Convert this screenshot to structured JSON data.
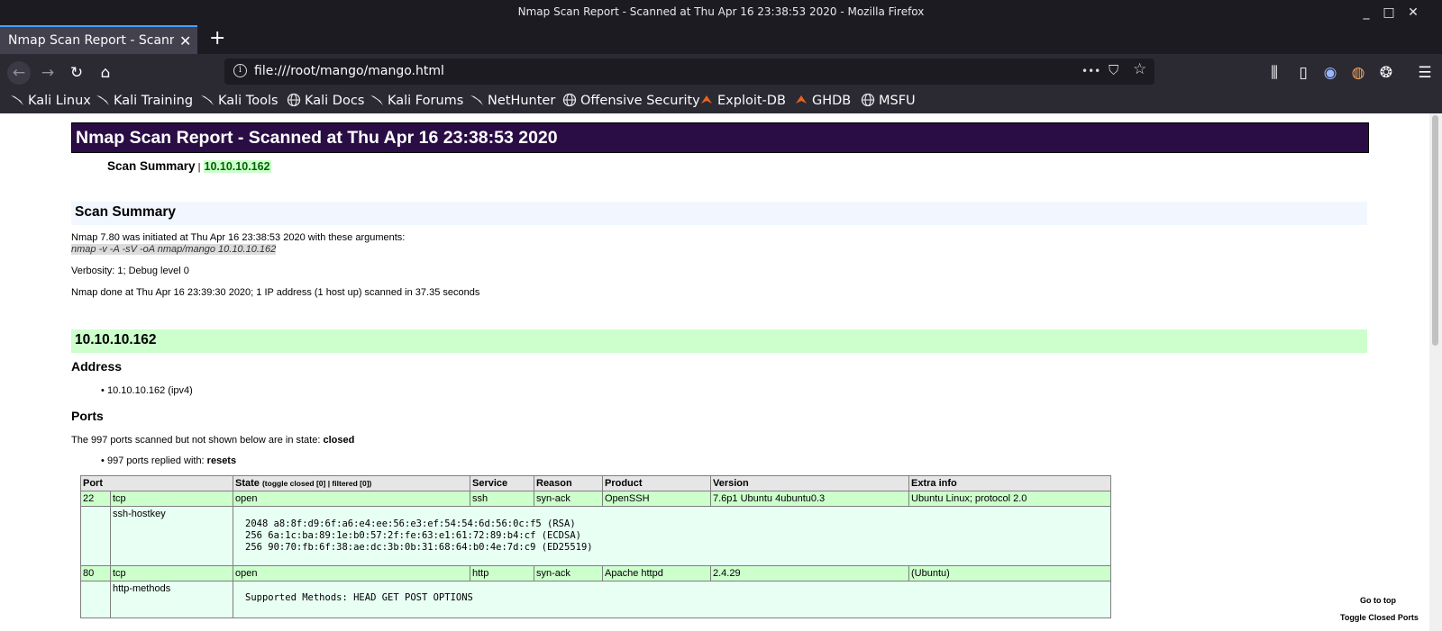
{
  "window": {
    "title": "Nmap Scan Report - Scanned at Thu Apr 16 23:38:53 2020 - Mozilla Firefox",
    "minimize": "_",
    "maximize": "□",
    "close": "✕"
  },
  "tabs": [
    {
      "label": "Nmap Scan Report - Scanned at Thu Apr 16 23:38:53 2020",
      "close": "✕"
    }
  ],
  "new_tab": "+",
  "nav": {
    "back": "←",
    "forward": "→",
    "reload": "↻",
    "home": "⌂",
    "url": "file:///root/mango/mango.html",
    "info": "i",
    "more": "•••",
    "pocket": "⛉",
    "star": "☆",
    "library": "⫼",
    "sidebar": "▯",
    "account": "◉",
    "addon": "◍",
    "extension": "❂",
    "menu": "☰"
  },
  "bookmarks": [
    {
      "label": "Kali Linux",
      "icon": "kali-dragon-icon"
    },
    {
      "label": "Kali Training",
      "icon": "kali-dragon-icon"
    },
    {
      "label": "Kali Tools",
      "icon": "kali-dragon-icon"
    },
    {
      "label": "Kali Docs",
      "icon": "globe-icon"
    },
    {
      "label": "Kali Forums",
      "icon": "kali-dragon-icon"
    },
    {
      "label": "NetHunter",
      "icon": "kali-dragon-icon"
    },
    {
      "label": "Offensive Security",
      "icon": "globe-icon"
    },
    {
      "label": "Exploit-DB",
      "icon": "exploit-db-icon"
    },
    {
      "label": "GHDB",
      "icon": "exploit-db-icon"
    },
    {
      "label": "MSFU",
      "icon": "globe-icon"
    }
  ],
  "report": {
    "banner": "Nmap Scan Report - Scanned at Thu Apr 16 23:38:53 2020",
    "nav_summary": "Scan Summary",
    "nav_sep": " | ",
    "nav_ip": "10.10.10.162",
    "summary_heading": "Scan Summary",
    "initiated": "Nmap 7.80 was initiated at Thu Apr 16 23:38:53 2020 with these arguments:",
    "arguments": "nmap -v -A -sV -oA nmap/mango 10.10.10.162",
    "verbosity": "Verbosity: 1; Debug level 0",
    "done": "Nmap done at Thu Apr 16 23:39:30 2020; 1 IP address (1 host up) scanned in 37.35 seconds",
    "host_heading": "10.10.10.162",
    "address_heading": "Address",
    "address_item": "10.10.10.162 (ipv4)",
    "ports_heading": "Ports",
    "closed_text": "The 997 ports scanned but not shown below are in state: ",
    "closed_state": "closed",
    "replied_text": "997 ports replied with: ",
    "replied_reason": "resets",
    "go_to_top": "Go to top",
    "toggle_closed": "Toggle Closed Ports"
  },
  "ports_table": {
    "headers": {
      "port": "Port",
      "state": "State",
      "state_toggle": "(toggle closed [0] | filtered [0])",
      "service": "Service",
      "reason": "Reason",
      "product": "Product",
      "version": "Version",
      "extra": "Extra info"
    },
    "rows": [
      {
        "port": "22",
        "proto": "tcp",
        "state": "open",
        "service": "ssh",
        "reason": "syn-ack",
        "product": "OpenSSH",
        "version": "7.6p1 Ubuntu 4ubuntu0.3",
        "extra": "Ubuntu Linux; protocol 2.0",
        "script_name": "ssh-hostkey",
        "script_output": "2048 a8:8f:d9:6f:a6:e4:ee:56:e3:ef:54:54:6d:56:0c:f5 (RSA)\n256 6a:1c:ba:89:1e:b0:57:2f:fe:63:e1:61:72:89:b4:cf (ECDSA)\n256 90:70:fb:6f:38:ae:dc:3b:0b:31:68:64:b0:4e:7d:c9 (ED25519)"
      },
      {
        "port": "80",
        "proto": "tcp",
        "state": "open",
        "service": "http",
        "reason": "syn-ack",
        "product": "Apache httpd",
        "version": "2.4.29",
        "extra": "(Ubuntu)",
        "script_name": "http-methods",
        "script_output": "Supported Methods: HEAD GET POST OPTIONS"
      }
    ]
  },
  "colors": {
    "banner_bg": "#2a0d45",
    "host_bg": "#ccffcc",
    "summary_bg": "#f2f7ff",
    "script_bg": "#e8fff4",
    "chrome_dark": "#1c1b22",
    "tab_accent": "#45a1ff"
  }
}
